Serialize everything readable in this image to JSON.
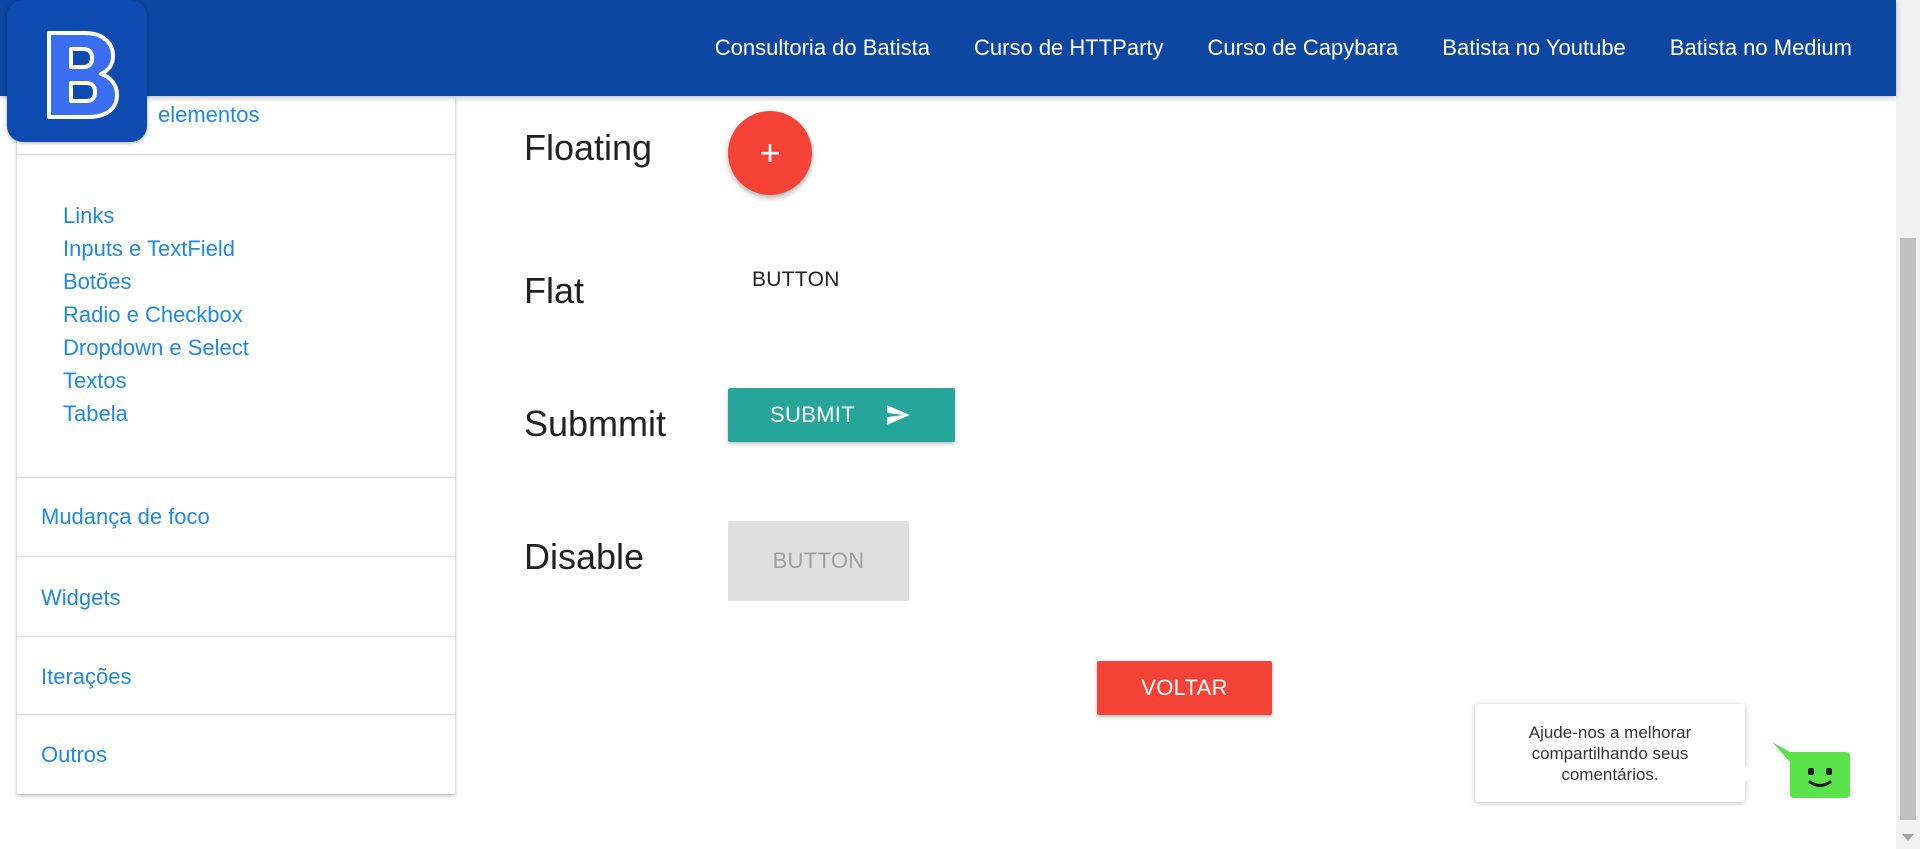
{
  "topbar": {
    "logo_letter": "B",
    "nav": [
      {
        "label": "Consultoria do Batista"
      },
      {
        "label": "Curso de HTTParty"
      },
      {
        "label": "Curso de Capybara"
      },
      {
        "label": "Batista no Youtube"
      },
      {
        "label": "Batista no Medium"
      }
    ]
  },
  "sidebar": {
    "partial_category": "elementos",
    "sub_items": [
      {
        "label": "Links"
      },
      {
        "label": "Inputs e TextField"
      },
      {
        "label": "Botões"
      },
      {
        "label": "Radio e Checkbox"
      },
      {
        "label": "Dropdown e Select"
      },
      {
        "label": "Textos"
      },
      {
        "label": "Tabela"
      }
    ],
    "categories": [
      {
        "label": "Mudança de foco"
      },
      {
        "label": "Widgets"
      },
      {
        "label": "Iterações"
      },
      {
        "label": "Outros"
      }
    ]
  },
  "main": {
    "floating": {
      "label": "Floating",
      "button_glyph": "+"
    },
    "flat": {
      "label": "Flat",
      "button_label": "BUTTON"
    },
    "submit": {
      "label": "Submmit",
      "button_label": "SUBMIT"
    },
    "disable": {
      "label": "Disable",
      "button_label": "BUTTON"
    },
    "back_button": "VOLTAR"
  },
  "feedback": {
    "message": "Ajude-nos a melhorar compartilhando seus comentários."
  },
  "colors": {
    "header": "#0d47a1",
    "link": "#1e88e5",
    "fab_red": "#f44336",
    "submit_teal": "#26a69a",
    "disabled_gray": "#dfdfdf",
    "feedback_green": "#5be34b"
  }
}
